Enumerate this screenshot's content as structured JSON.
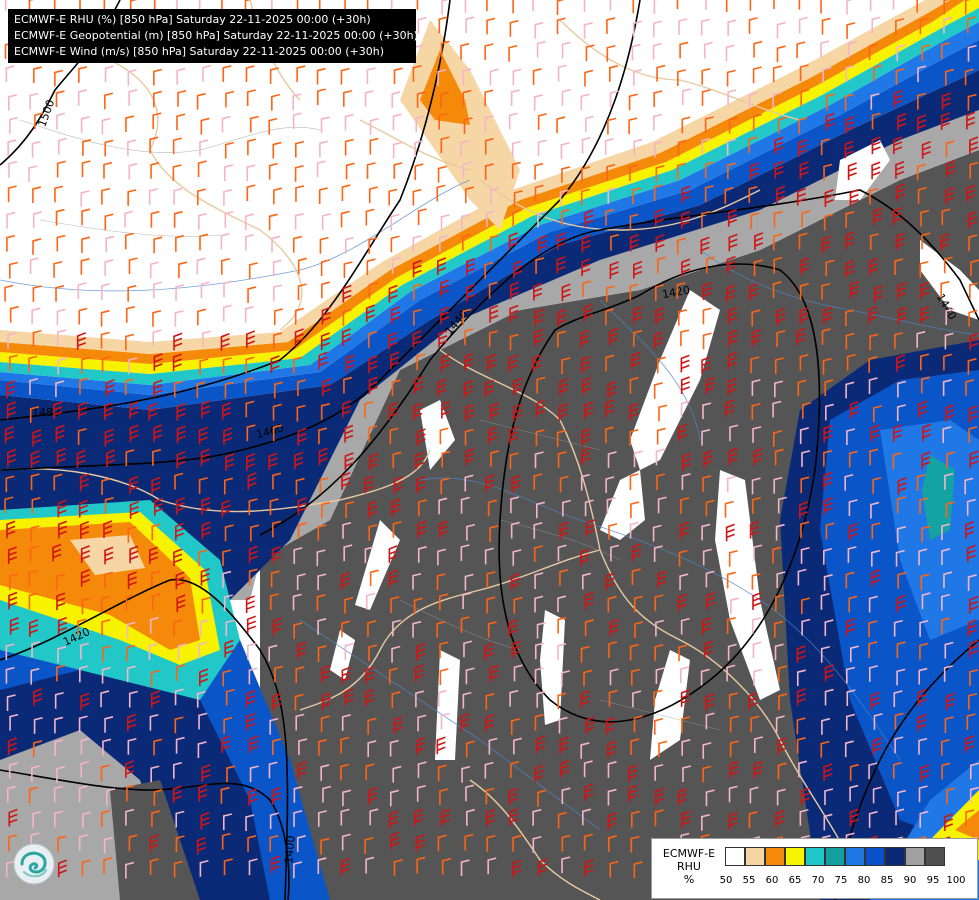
{
  "titles": [
    "ECMWF-E RHU (%) [850 hPa] Saturday 22-11-2025 00:00 (+30h)",
    "ECMWF-E Geopotential (m) [850 hPa] Saturday 22-11-2025 00:00 (+30h)",
    "ECMWF-E Wind (m/s) [850 hPa] Saturday 22-11-2025 00:00 (+30h)"
  ],
  "legend": {
    "line1": "ECMWF-E",
    "line2": "RHU",
    "line3": "%",
    "ticks": [
      "50",
      "55",
      "60",
      "65",
      "70",
      "75",
      "80",
      "85",
      "90",
      "95",
      "100"
    ],
    "colors": [
      "#ffffff",
      "#f5d6a4",
      "#f58a0a",
      "#f5f500",
      "#1ec8c8",
      "#14a0a0",
      "#1e78e6",
      "#0a50c8",
      "#0a2873",
      "#a0a0a0",
      "#505050"
    ]
  },
  "contours": [
    "1500",
    "1480",
    "1460",
    "1440",
    "1420",
    "1420",
    "1440",
    "1400"
  ],
  "logo": {
    "icon": "brand-swirl-icon"
  },
  "map_colors": {
    "dark_gray": "#555555",
    "light_gray": "#a8a8a8",
    "navy": "#0a2a78",
    "blue": "#0a55c8",
    "mid_blue": "#1f78e6",
    "teal": "#14a3a3",
    "cyan": "#22c8c8",
    "yellow": "#f6f200",
    "orange": "#f58a0a",
    "peach": "#f5d6a4",
    "border": "#e8c9a0",
    "river": "#4f86c9"
  }
}
